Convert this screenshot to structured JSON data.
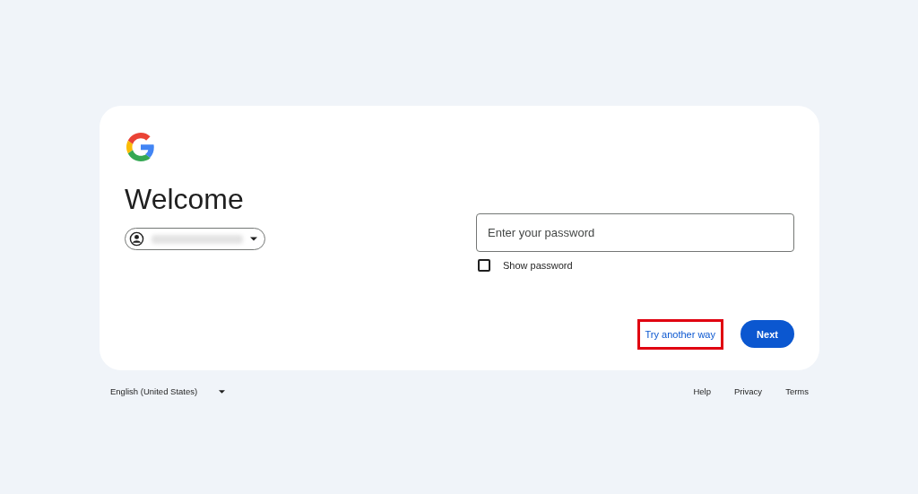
{
  "heading": "Welcome",
  "account_chip": {
    "expanded": false
  },
  "password_field": {
    "placeholder": "Enter your password"
  },
  "show_password": {
    "label": "Show password",
    "checked": false
  },
  "try_another_way": {
    "label": "Try another way",
    "highlighted": true
  },
  "next_button": {
    "label": "Next"
  },
  "footer": {
    "language": "English (United States)",
    "links": [
      "Help",
      "Privacy",
      "Terms"
    ]
  }
}
